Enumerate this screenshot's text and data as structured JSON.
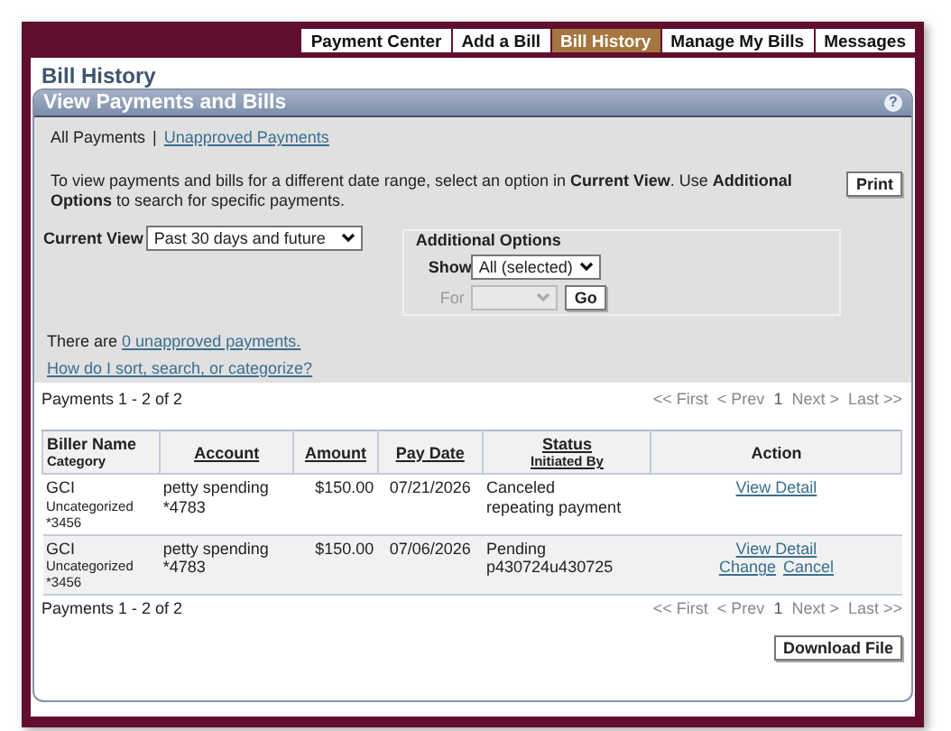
{
  "tabs": [
    {
      "label": "Payment Center",
      "selected": false
    },
    {
      "label": "Add a Bill",
      "selected": false
    },
    {
      "label": "Bill History",
      "selected": true
    },
    {
      "label": "Manage My Bills",
      "selected": false
    },
    {
      "label": "Messages",
      "selected": false
    }
  ],
  "page_title": "Bill History",
  "panel": {
    "title": "View Payments and Bills",
    "help": "?"
  },
  "view_links": [
    {
      "label": "All Payments",
      "selected": true
    },
    {
      "label": "Unapproved Payments",
      "selected": false
    }
  ],
  "view_separator": "|",
  "intro": "To view payments and bills for a different date range, select an option in **Current View**. Use **Additional Options** to search for specific payments.",
  "print_button": "Print",
  "current_view": {
    "label": "Current View",
    "value": "Past 30 days and future"
  },
  "additional_options": {
    "title": "Additional Options",
    "show_label": "Show",
    "show_value": "All (selected)",
    "for_label": "For",
    "for_disabled": true,
    "go_button": "Go"
  },
  "unapproved_prefix": "There are",
  "unapproved_link": "0 unapproved payments.",
  "help_link": "How do I sort, search, or categorize?",
  "pager_top": {
    "summary": "Payments 1 - 2 of 2",
    "links": [
      {
        "label": "<< First",
        "kind": "nav"
      },
      {
        "label": "< Prev",
        "kind": "nav"
      },
      {
        "label": "1",
        "kind": "current"
      },
      {
        "label": "Next >",
        "kind": "nav"
      },
      {
        "label": "Last >>",
        "kind": "nav"
      }
    ]
  },
  "table": {
    "columns": [
      {
        "label": "Biller Name",
        "sub": "Category",
        "sortable": false
      },
      {
        "label": "Account",
        "sortable": true
      },
      {
        "label": "Amount",
        "sortable": true
      },
      {
        "label": "Pay Date",
        "sortable": true
      },
      {
        "label": "Status",
        "sub": "Initiated By",
        "sortable": true
      },
      {
        "label": "Action",
        "sortable": false
      }
    ],
    "rows": [
      {
        "biller": "GCI",
        "category": "Uncategorized",
        "biller_account": "*3456",
        "account": "petty spending",
        "account_number": "*4783",
        "amount": "$150.00",
        "pay_date": "07/21/2026",
        "status": "Canceled",
        "initiated_by": "repeating payment",
        "actions": [
          "View Detail"
        ]
      },
      {
        "biller": "GCI",
        "category": "Uncategorized",
        "biller_account": "*3456",
        "account": "petty spending",
        "account_number": "*4783",
        "amount": "$150.00",
        "pay_date": "07/06/2026",
        "status": "Pending",
        "initiated_by": "p430724u430725",
        "actions": [
          "View Detail",
          "Change",
          "Cancel"
        ]
      }
    ]
  },
  "pager_bottom": {
    "summary": "Payments 1 - 2 of 2",
    "links": [
      {
        "label": "<< First",
        "kind": "nav"
      },
      {
        "label": "< Prev",
        "kind": "nav"
      },
      {
        "label": "1",
        "kind": "current"
      },
      {
        "label": "Next >",
        "kind": "nav"
      },
      {
        "label": "Last >>",
        "kind": "nav"
      }
    ]
  },
  "download_button": "Download File"
}
